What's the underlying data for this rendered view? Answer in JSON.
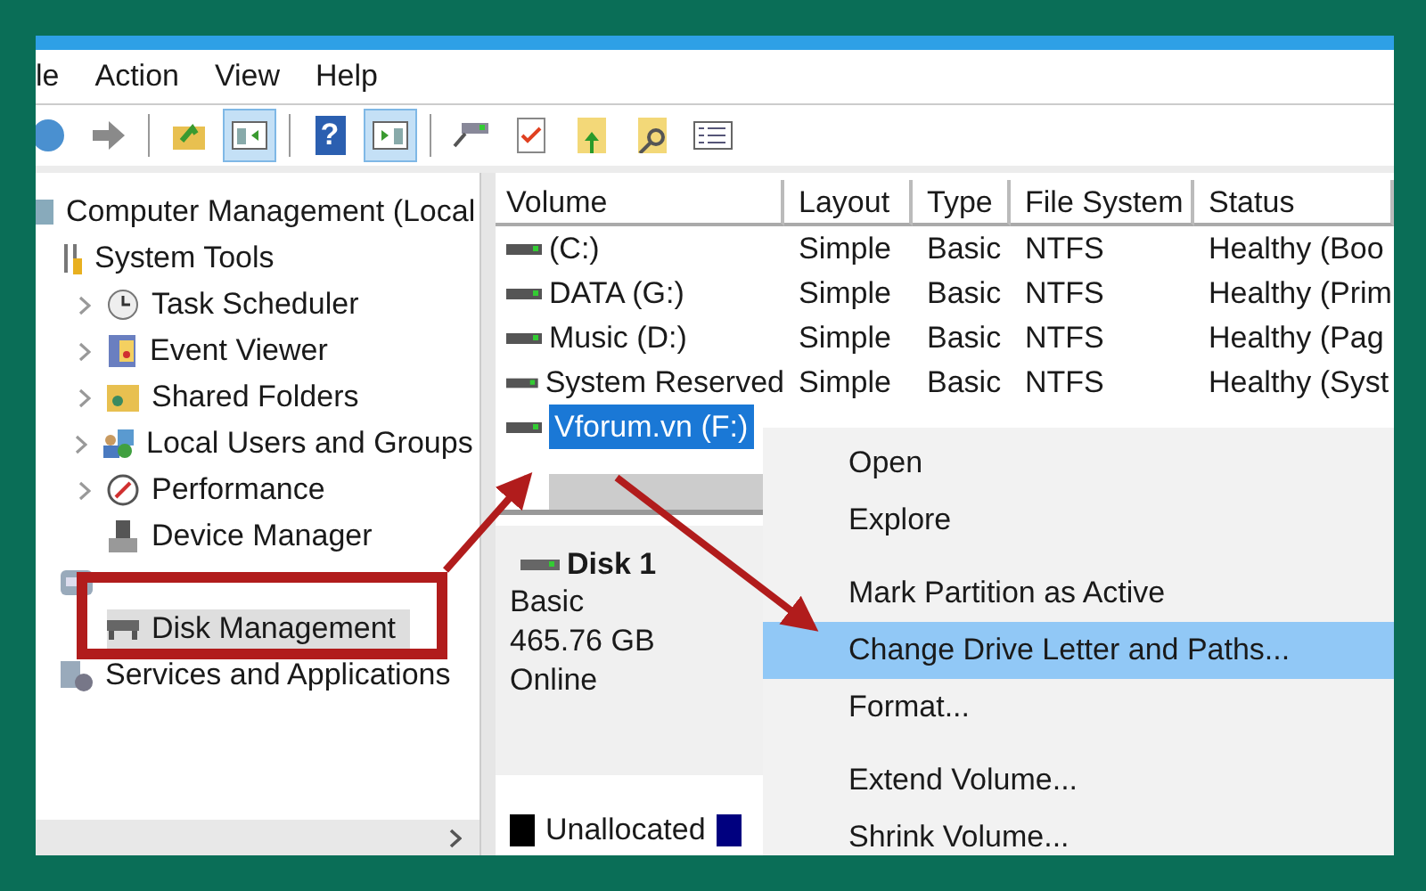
{
  "menu_bar": [
    "le",
    "Action",
    "View",
    "Help"
  ],
  "toolbar": [
    [
      {
        "kind": "back",
        "pressed": false
      },
      {
        "kind": "forward",
        "pressed": false
      }
    ],
    [
      {
        "kind": "up",
        "pressed": false
      },
      {
        "kind": "pane-left",
        "pressed": true
      }
    ],
    [
      {
        "kind": "help",
        "label": "?",
        "pressed": false
      },
      {
        "kind": "pane-right",
        "pressed": true
      }
    ],
    [
      {
        "kind": "connect",
        "pressed": false
      },
      {
        "kind": "check",
        "pressed": false
      },
      {
        "kind": "export",
        "pressed": false
      },
      {
        "kind": "find",
        "pressed": false
      },
      {
        "kind": "list",
        "pressed": false
      }
    ]
  ],
  "tree": [
    {
      "label": "Computer Management (Local",
      "kind": "computer",
      "collapsed": false,
      "selected": false,
      "children": [
        {
          "label": "System Tools",
          "kind": "tools",
          "collapsed": false,
          "selected": false,
          "children": [
            {
              "label": "Task Scheduler",
              "kind": "clock",
              "collapsed": true,
              "selected": false
            },
            {
              "label": "Event Viewer",
              "kind": "log",
              "collapsed": true,
              "selected": false
            },
            {
              "label": "Shared Folders",
              "kind": "folder",
              "collapsed": true,
              "selected": false
            },
            {
              "label": "Local Users and Groups",
              "kind": "users",
              "collapsed": true,
              "selected": false
            },
            {
              "label": "Performance",
              "kind": "gauge",
              "collapsed": true,
              "selected": false
            },
            {
              "label": "Device Manager",
              "kind": "device",
              "collapsed": false,
              "selected": false
            }
          ]
        },
        {
          "kind": "storage",
          "collapsed": false,
          "selected": false,
          "children": [
            {
              "label": "Disk Management",
              "kind": "drive",
              "collapsed": false,
              "selected": true
            }
          ]
        },
        {
          "label": "Services and Applications",
          "kind": "services",
          "collapsed": false,
          "selected": false
        }
      ]
    }
  ],
  "table": {
    "columns": [
      "Volume",
      "Layout",
      "Type",
      "File System",
      "Status"
    ],
    "rows": [
      {
        "cells": [
          "(C:)",
          "Simple",
          "Basic",
          "NTFS",
          "Healthy (Boo"
        ],
        "selected": false
      },
      {
        "cells": [
          "DATA (G:)",
          "Simple",
          "Basic",
          "NTFS",
          "Healthy (Prim"
        ],
        "selected": false
      },
      {
        "cells": [
          "Music (D:)",
          "Simple",
          "Basic",
          "NTFS",
          "Healthy (Pag"
        ],
        "selected": false
      },
      {
        "cells": [
          "System Reserved",
          "Simple",
          "Basic",
          "NTFS",
          "Healthy (Syst"
        ],
        "selected": false
      },
      {
        "cells": [
          "Vforum.vn (F:)"
        ],
        "selected": true
      }
    ]
  },
  "disk": {
    "name": "Disk 1",
    "lines": [
      "Basic",
      "465.76 GB",
      "Online"
    ]
  },
  "legend": [
    {
      "label": "Unallocated",
      "color": "#000000"
    },
    {
      "color": "#00007f"
    }
  ],
  "context_menu": [
    {
      "kind": "item",
      "label": "Open",
      "selected": false
    },
    {
      "kind": "item",
      "label": "Explore",
      "selected": false
    },
    {
      "kind": "separator"
    },
    {
      "kind": "item",
      "label": "Mark Partition as Active",
      "selected": false
    },
    {
      "kind": "item",
      "label": "Change Drive Letter and Paths...",
      "selected": true
    },
    {
      "kind": "item",
      "label": "Format...",
      "selected": false
    },
    {
      "kind": "separator"
    },
    {
      "kind": "item",
      "label": "Extend Volume...",
      "selected": false
    },
    {
      "kind": "item",
      "label": "Shrink Volume...",
      "selected": false
    }
  ]
}
